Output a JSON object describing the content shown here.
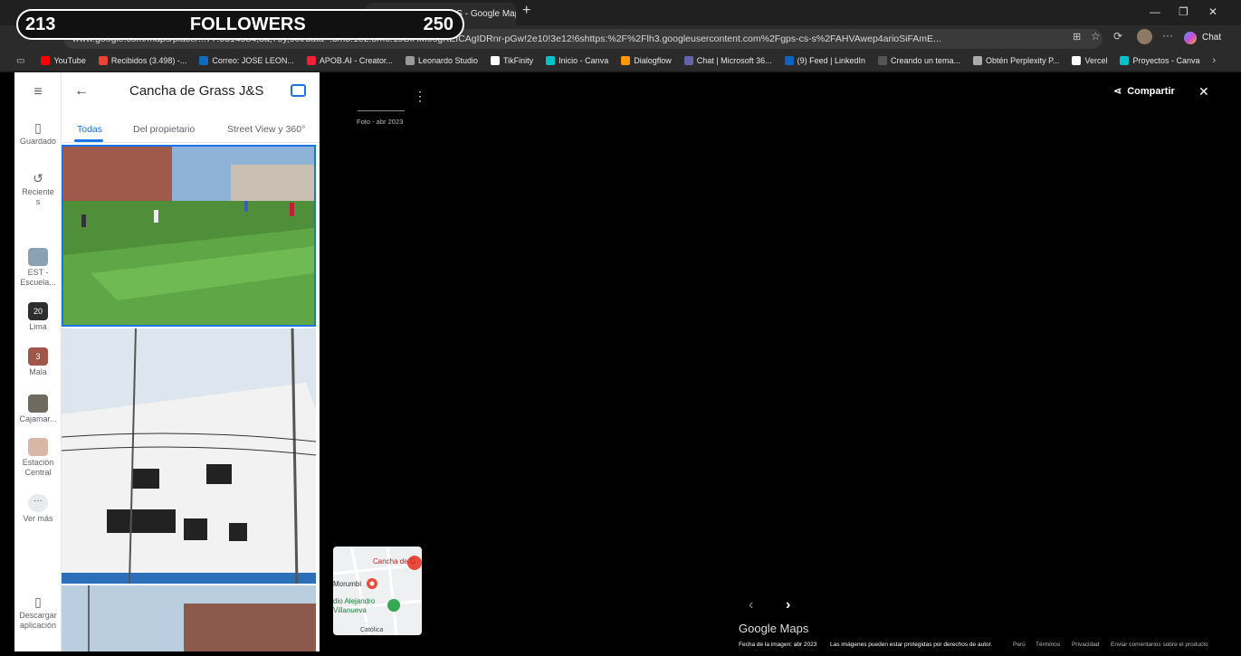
{
  "overlay": {
    "count": "213",
    "label": "FOLLOWERS",
    "goal": "250"
  },
  "browser": {
    "active_tab": "Cancha de Grass J&S - Google Maps",
    "url": "www.google.com/maps/place/...77.0314584,3a,75y,90t/data=!3m8!1e2!3m6!1sCIHM0ogKEICAgIDRnr-pGw!2e10!3e12!6shttps:%2F%2Flh3.googleusercontent.com%2Fgps-cs-s%2FAHVAwep4arioSiFAmE...",
    "chat_label": "Chat",
    "bookmarks": [
      {
        "label": "YouTube",
        "color": "#ff0000"
      },
      {
        "label": "Recibidos (3.498) -...",
        "color": "#ea4335"
      },
      {
        "label": "Correo: JOSE LEON...",
        "color": "#0f6cbd"
      },
      {
        "label": "APOB.AI - Creator...",
        "color": "#e23"
      },
      {
        "label": "Leonardo Studio",
        "color": "#999"
      },
      {
        "label": "TikFinity",
        "color": "#fff"
      },
      {
        "label": "Inicio - Canva",
        "color": "#00c4cc"
      },
      {
        "label": "Dialogflow",
        "color": "#ff9800"
      },
      {
        "label": "Chat | Microsoft 36...",
        "color": "#6264a7"
      },
      {
        "label": "(9) Feed | LinkedIn",
        "color": "#0a66c2"
      },
      {
        "label": "Creando un tema...",
        "color": "#555"
      },
      {
        "label": "Obtén Perplexity P...",
        "color": "#aaa"
      },
      {
        "label": "Vercel",
        "color": "#fff"
      },
      {
        "label": "Proyectos - Canva",
        "color": "#00c4cc"
      }
    ]
  },
  "rail": {
    "guardado": "Guardado",
    "recientes": "Reciente s",
    "est": "EST - Escuela...",
    "lima": "Lima",
    "lima_badge": "20",
    "mala": "Mala",
    "mala_badge": "3",
    "cajamarca": "Cajamar...",
    "estacion": "Estación Central",
    "ver_mas": "Ver más",
    "descargar": "Descargar aplicación"
  },
  "panel": {
    "title": "Cancha de Grass J&S",
    "tabs": [
      "Todas",
      "Del propietario",
      "Street View y 360°"
    ]
  },
  "viewer": {
    "photo_date": "Foto - abr 2023",
    "share": "Compartir",
    "map_label_place": "Cancha de G",
    "map_label_morumbi": "Morumbi",
    "map_label_estadio": "dio Alejandro Villanueva",
    "map_label_catolica": "Católica",
    "brand": "Google Maps",
    "footer": {
      "fecha": "Fecha de la imagen: abr 2023",
      "rights": "Las imágenes pueden estar protegidas por derechos de autor.",
      "peru": "Perú",
      "terminos": "Términos",
      "privacidad": "Privacidad",
      "enviar": "Enviar comentarios sobre el producto"
    }
  }
}
